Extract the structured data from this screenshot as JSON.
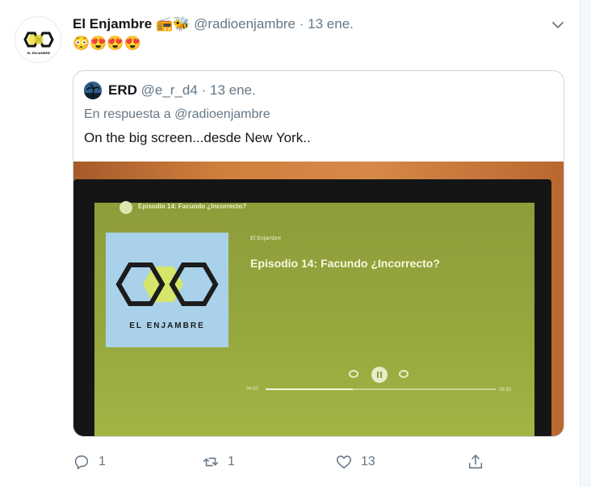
{
  "tweet": {
    "name": "El Enjambre",
    "name_emojis": "📻🐝",
    "handle": "@radioenjambre",
    "separator": "·",
    "time": "13 ene.",
    "emojis": "😳😍😍😍",
    "avatar_text": "EL ENJAMBRE"
  },
  "quote": {
    "name": "ERD",
    "handle": "@e_r_d4",
    "separator": "·",
    "time": "13 ene.",
    "reply_prefix": "En respuesta a",
    "reply_mention": "@radioenjambre",
    "text": "On the big screen...desde New York..",
    "photo": {
      "episode_small": "Episodio 14: Facundo ¿Incorrecto?",
      "artist": "El Enjambre",
      "episode_title": "Episodio 14: Facundo ¿Incorrecto?",
      "cover_text": "EL ENJAMBRE",
      "time_start": "04:07",
      "time_end": "08:30",
      "progress_fraction": 0.38
    }
  },
  "actions": {
    "reply_count": "1",
    "retweet_count": "1",
    "like_count": "13",
    "share_count": ""
  },
  "colors": {
    "secondary_text": "#657786",
    "border": "#ccd6dd",
    "screen_green": "#97a83e",
    "hex_accent": "#d5e66a"
  }
}
